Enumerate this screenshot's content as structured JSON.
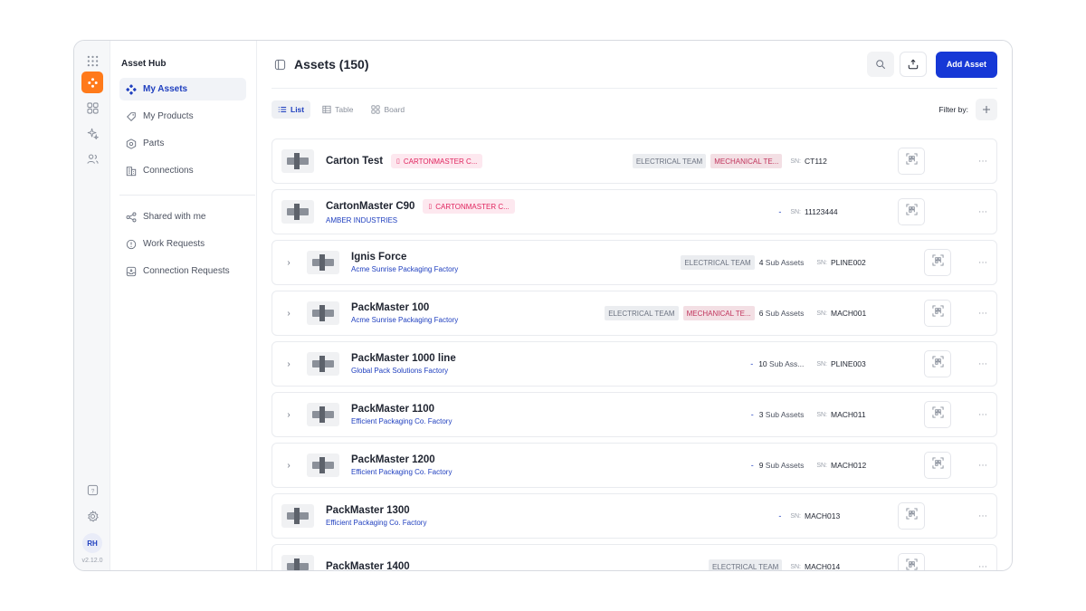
{
  "app": {
    "version": "v2.12.0",
    "avatar": "RH"
  },
  "rail": {
    "icons": [
      "apps-grid-icon",
      "asset-hub-icon",
      "dashboard-icon",
      "sparkle-icon",
      "users-icon",
      "help-icon",
      "settings-icon"
    ]
  },
  "sidebar": {
    "title": "Asset Hub",
    "items": [
      {
        "label": "My Assets",
        "icon": "assets-icon",
        "active": true
      },
      {
        "label": "My Products",
        "icon": "tag-icon",
        "active": false
      },
      {
        "label": "Parts",
        "icon": "hexagon-icon",
        "active": false
      },
      {
        "label": "Connections",
        "icon": "building-icon",
        "active": false
      }
    ],
    "items2": [
      {
        "label": "Shared with me",
        "icon": "share-icon"
      },
      {
        "label": "Work Requests",
        "icon": "alert-circle-icon"
      },
      {
        "label": "Connection Requests",
        "icon": "inbox-icon"
      }
    ]
  },
  "header": {
    "title": "Assets (150)",
    "add_label": "Add Asset",
    "accent": "#1638d6"
  },
  "views": {
    "tabs": [
      "List",
      "Table",
      "Board"
    ],
    "filter_label": "Filter by:"
  },
  "assets": [
    {
      "name": "Carton Test",
      "org": "",
      "chip": "CARTONMASTER C...",
      "tags": [
        "ELECTRICAL TEAM",
        "MECHANICAL TE..."
      ],
      "sub": "",
      "sn_label": "SN:",
      "sn": "CT112",
      "expandable": false
    },
    {
      "name": "CartonMaster C90",
      "org": "AMBER INDUSTRIES",
      "chip": "CARTONMASTER C...",
      "tags": [],
      "dash": "-",
      "sub": "",
      "sn_label": "SN:",
      "sn": "11123444",
      "expandable": false
    },
    {
      "name": "Ignis Force",
      "org": "Acme Sunrise Packaging Factory",
      "chip": "",
      "tags": [
        "ELECTRICAL TEAM"
      ],
      "sub_count": "4",
      "sub_label": "Sub Assets",
      "sn_label": "SN:",
      "sn": "PLINE002",
      "expandable": true
    },
    {
      "name": "PackMaster 100",
      "org": "Acme Sunrise Packaging Factory",
      "chip": "",
      "tags": [
        "ELECTRICAL TEAM",
        "MECHANICAL TE..."
      ],
      "sub_count": "6",
      "sub_label": "Sub Assets",
      "sn_label": "SN:",
      "sn": "MACH001",
      "expandable": true
    },
    {
      "name": "PackMaster 1000 line",
      "org": "Global Pack Solutions Factory",
      "chip": "",
      "tags": [],
      "dash": "-",
      "sub_count": "10",
      "sub_label": "Sub Ass...",
      "sn_label": "SN:",
      "sn": "PLINE003",
      "expandable": true
    },
    {
      "name": "PackMaster 1100",
      "org": "Efficient Packaging Co. Factory",
      "chip": "",
      "tags": [],
      "dash": "-",
      "sub_count": "3",
      "sub_label": "Sub Assets",
      "sn_label": "SN:",
      "sn": "MACH011",
      "expandable": true
    },
    {
      "name": "PackMaster 1200",
      "org": "Efficient Packaging Co. Factory",
      "chip": "",
      "tags": [],
      "dash": "-",
      "sub_count": "9",
      "sub_label": "Sub Assets",
      "sn_label": "SN:",
      "sn": "MACH012",
      "expandable": true
    },
    {
      "name": "PackMaster 1300",
      "org": "Efficient Packaging Co. Factory",
      "chip": "",
      "tags": [],
      "dash": "-",
      "sub": "",
      "sn_label": "SN:",
      "sn": "MACH013",
      "expandable": false
    },
    {
      "name": "PackMaster 1400",
      "org": "",
      "chip": "",
      "tags": [
        "ELECTRICAL TEAM"
      ],
      "sub": "",
      "sn_label": "SN:",
      "sn": "MACH014",
      "expandable": false
    }
  ]
}
